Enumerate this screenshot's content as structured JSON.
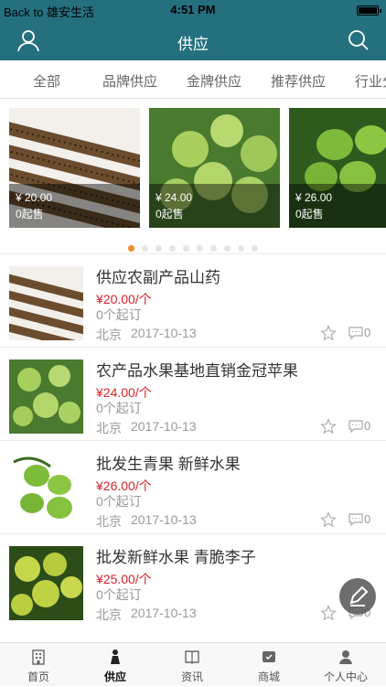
{
  "status": {
    "back": "Back to 雄安生活",
    "time": "4:51 PM"
  },
  "nav": {
    "title": "供应"
  },
  "tabs": [
    "全部",
    "品牌供应",
    "金牌供应",
    "推荐供应",
    "行业分"
  ],
  "carousel": [
    {
      "price": "¥ 20.00",
      "moq": "0起售",
      "img": "yam"
    },
    {
      "price": "¥ 24.00",
      "moq": "0起售",
      "img": "green-apple"
    },
    {
      "price": "¥ 26.00",
      "moq": "0起售",
      "img": "green-fruit"
    }
  ],
  "products": [
    {
      "title": "供应农副产品山药",
      "price": "¥20.00/个",
      "moq": "0个起订",
      "location": "北京",
      "date": "2017-10-13",
      "comments": "0",
      "img": "yam"
    },
    {
      "title": "农产品水果基地直销金冠苹果",
      "price": "¥24.00/个",
      "moq": "0个起订",
      "location": "北京",
      "date": "2017-10-13",
      "comments": "0",
      "img": "green-apple"
    },
    {
      "title": "批发生青果 新鲜水果",
      "price": "¥26.00/个",
      "moq": "0个起订",
      "location": "北京",
      "date": "2017-10-13",
      "comments": "0",
      "img": "green-fruit"
    },
    {
      "title": "批发新鲜水果 青脆李子",
      "price": "¥25.00/个",
      "moq": "0个起订",
      "location": "北京",
      "date": "2017-10-13",
      "comments": "0",
      "img": "plum"
    }
  ],
  "tabbar": [
    {
      "label": "首页",
      "icon": "building-icon"
    },
    {
      "label": "供应",
      "icon": "person-icon",
      "active": true
    },
    {
      "label": "资讯",
      "icon": "book-icon"
    },
    {
      "label": "商城",
      "icon": "shop-icon"
    },
    {
      "label": "个人中心",
      "icon": "user-icon"
    }
  ],
  "colors": {
    "brand": "#25707f",
    "price": "#d9222a",
    "dot_active": "#f08a2a"
  }
}
